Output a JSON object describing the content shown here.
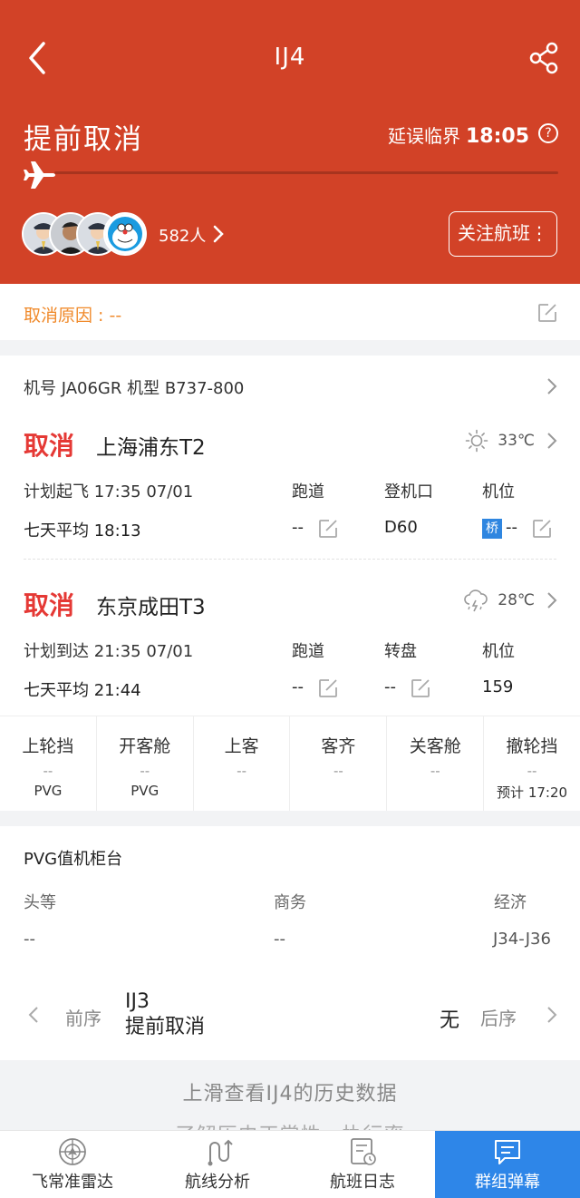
{
  "header": {
    "title": "IJ4",
    "status": "提前取消",
    "delay_label": "延误临界",
    "delay_time": "18:05",
    "help_symbol": "?",
    "people_count": "582人",
    "follow_label": "关注航班⋮"
  },
  "reason": {
    "text": "取消原因 : --"
  },
  "aircraft": {
    "text": "机号  JA06GR    机型  B737-800"
  },
  "departure": {
    "status": "取消",
    "airport": "上海浦东T2",
    "temp": "33℃",
    "weather_icon": "sun-icon",
    "col1_label": "计划起飞 17:35 07/01",
    "col2_label": "跑道",
    "col3_label": "登机口",
    "col4_label": "机位",
    "avg": "七天平均 18:13",
    "runway": "--",
    "gate": "D60",
    "bridge": "桥",
    "stand": "--"
  },
  "arrival": {
    "status": "取消",
    "airport": "东京成田T3",
    "temp": "28℃",
    "weather_icon": "thunderstorm-icon",
    "col1_label": "计划到达 21:35 07/01",
    "col2_label": "跑道",
    "col3_label": "转盘",
    "col4_label": "机位",
    "avg": "七天平均 21:44",
    "runway": "--",
    "carousel": "--",
    "stand": "159"
  },
  "progress": [
    {
      "title": "上轮挡",
      "value": "--",
      "sub": "PVG"
    },
    {
      "title": "开客舱",
      "value": "--",
      "sub": "PVG"
    },
    {
      "title": "上客",
      "value": "--",
      "sub": ""
    },
    {
      "title": "客齐",
      "value": "--",
      "sub": ""
    },
    {
      "title": "关客舱",
      "value": "--",
      "sub": ""
    },
    {
      "title": "撤轮挡",
      "value": "--",
      "sub": "预计 17:20"
    }
  ],
  "checkin": {
    "title": "PVG值机柜台",
    "first_label": "头等",
    "business_label": "商务",
    "economy_label": "经济",
    "first_value": "--",
    "business_value": "--",
    "economy_value": "J34-J36"
  },
  "sequence": {
    "prev_label": "前序",
    "prev_flight": "IJ3",
    "prev_status": "提前取消",
    "next_value": "无",
    "next_label": "后序"
  },
  "history": {
    "line1": "上滑查看IJ4的历史数据",
    "line2": "了解历史正常性、执行率"
  },
  "nav": [
    {
      "label": "飞常准雷达",
      "icon": "radar-icon"
    },
    {
      "label": "航线分析",
      "icon": "route-icon"
    },
    {
      "label": "航班日志",
      "icon": "log-icon"
    },
    {
      "label": "群组弹幕",
      "icon": "chat-icon"
    }
  ],
  "colors": {
    "header": "#d24227",
    "cancel": "#e53935",
    "reason": "#f08a2b",
    "active_nav": "#2e86e8"
  }
}
